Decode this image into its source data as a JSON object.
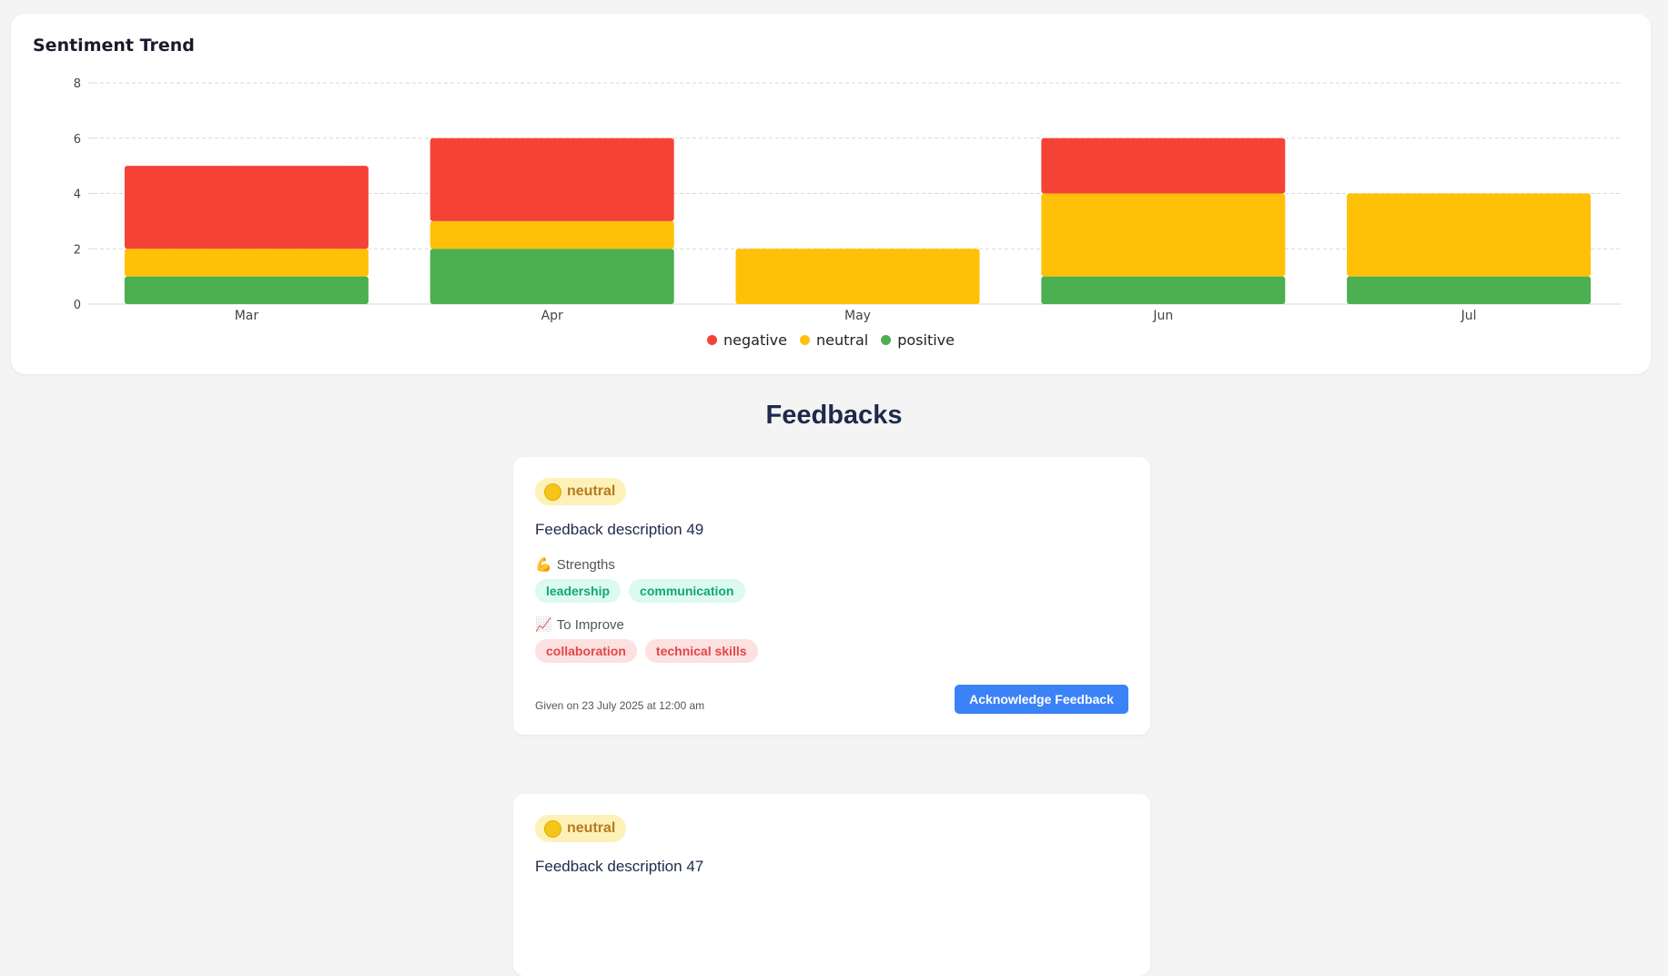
{
  "chart": {
    "title": "Sentiment Trend"
  },
  "chart_data": {
    "type": "bar",
    "stacked": true,
    "categories": [
      "Mar",
      "Apr",
      "May",
      "Jun",
      "Jul"
    ],
    "series": [
      {
        "name": "positive",
        "color": "#4caf50",
        "values": [
          1,
          2,
          0,
          1,
          1
        ]
      },
      {
        "name": "neutral",
        "color": "#ffc107",
        "values": [
          1,
          1,
          2,
          3,
          3
        ]
      },
      {
        "name": "negative",
        "color": "#f44336",
        "values": [
          3,
          3,
          0,
          2,
          0
        ]
      }
    ],
    "ylim": [
      0,
      8
    ],
    "yticks": [
      0,
      2,
      4,
      6,
      8
    ],
    "grid": true,
    "legend_position": "bottom",
    "legend_order": [
      "negative",
      "neutral",
      "positive"
    ]
  },
  "page": {
    "heading": "Feedbacks"
  },
  "feedbacks": [
    {
      "sentiment": "neutral",
      "description": "Feedback description 49",
      "strengths_label": "Strengths",
      "strengths": [
        "leadership",
        "communication"
      ],
      "improve_label": "To Improve",
      "improve": [
        "collaboration",
        "technical skills"
      ],
      "given": "Given on 23 July 2025 at 12:00 am",
      "action_label": "Acknowledge Feedback"
    },
    {
      "sentiment": "neutral",
      "description": "Feedback description 47"
    }
  ]
}
